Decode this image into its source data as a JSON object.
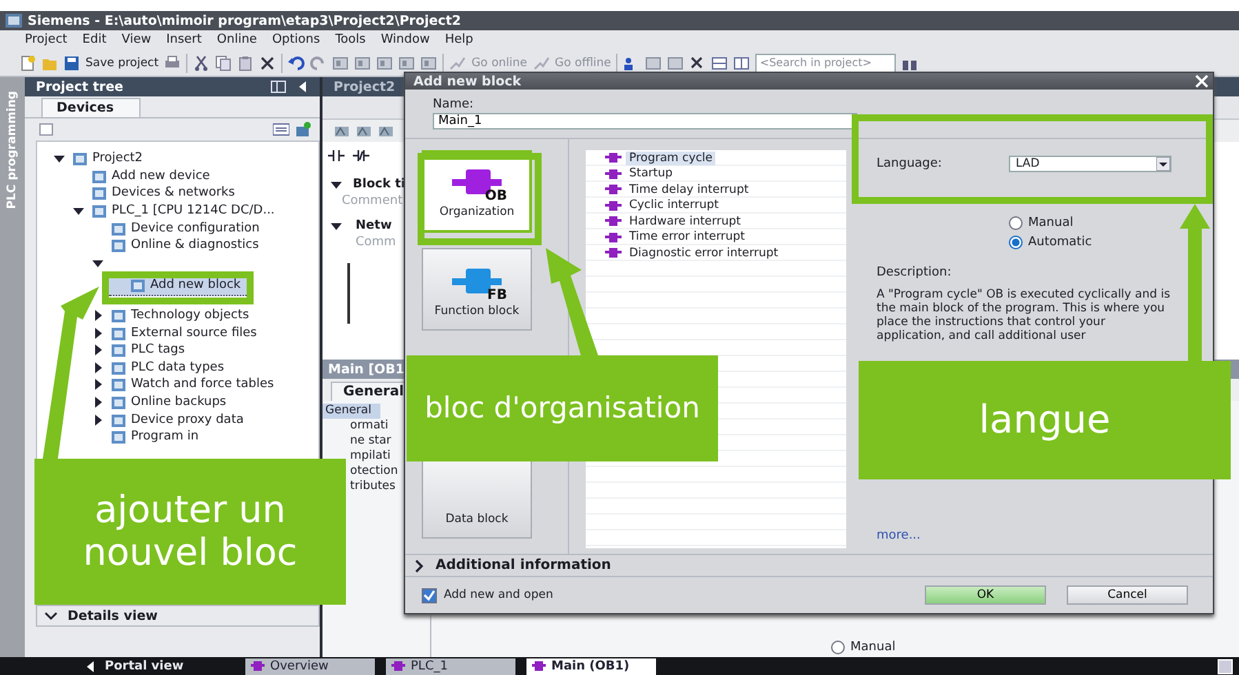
{
  "window": {
    "title": "Siemens - E:\\auto\\mimoir program\\etap3\\Project2\\Project2"
  },
  "menu": [
    "Project",
    "Edit",
    "View",
    "Insert",
    "Online",
    "Options",
    "Tools",
    "Window",
    "Help"
  ],
  "toolbar": {
    "save_label": "Save project",
    "go_online": "Go online",
    "go_offline": "Go offline",
    "search": {
      "placeholder": "<Search in project>"
    }
  },
  "side_tab": {
    "label": "PLC programming"
  },
  "project_tree": {
    "title": "Project tree",
    "tab": "Devices",
    "items": [
      {
        "label": "Project2",
        "expanded": true,
        "selected": false,
        "children": [
          {
            "label": "Add new device",
            "selected": false
          },
          {
            "label": "Devices & networks",
            "selected": false
          },
          {
            "label": "PLC_1 [CPU 1214C DC/D...",
            "expanded": true,
            "selected": false,
            "children": [
              {
                "label": "Device configuration",
                "selected": false
              },
              {
                "label": "Online & diagnostics",
                "selected": false
              },
              {
                "expanded": true,
                "selected": false,
                "children": [
                  {
                    "label": "Add new block",
                    "selected": true
                  }
                ]
              },
              {
                "label": "Technology objects",
                "expanded": false,
                "selected": false
              },
              {
                "label": "External source files",
                "expanded": false,
                "selected": false
              },
              {
                "label": "PLC tags",
                "expanded": false,
                "selected": false
              },
              {
                "label": "PLC data types",
                "expanded": false,
                "selected": false
              },
              {
                "label": "Watch and force tables",
                "expanded": false,
                "selected": false
              },
              {
                "label": "Online backups",
                "expanded": false,
                "selected": false
              },
              {
                "label": "Device proxy data",
                "expanded": false,
                "selected": false
              },
              {
                "label": "Program in",
                "selected": false
              }
            ]
          }
        ]
      }
    ],
    "details_view": "Details view"
  },
  "editor": {
    "breadcrumb": "Project2",
    "block_title": "Block ti",
    "comment": "Comment",
    "network": "Netw",
    "network_comment": "Comm",
    "properties": {
      "title": "Main [OB1",
      "tab": "General",
      "items": [
        "General",
        "ormati",
        "ne star",
        "mpilati",
        "otection",
        "tributes"
      ]
    },
    "manual": {
      "label": "Manual",
      "selected": false
    }
  },
  "dialog": {
    "title": "Add new block",
    "name_label": "Name:",
    "name_value": "Main_1",
    "block_types": [
      {
        "kind": "ob",
        "code": "OB",
        "label": "Organization",
        "selected": true
      },
      {
        "kind": "fb",
        "code": "FB",
        "label": "Function block",
        "selected": false
      },
      {
        "kind": "plain",
        "label": "Data block",
        "selected": false
      }
    ],
    "ob_types": [
      {
        "label": "Program cycle",
        "selected": true
      },
      {
        "label": "Startup",
        "selected": false
      },
      {
        "label": "Time delay interrupt",
        "selected": false
      },
      {
        "label": "Cyclic interrupt",
        "selected": false
      },
      {
        "label": "Hardware interrupt",
        "selected": false
      },
      {
        "label": "Time error interrupt",
        "selected": false
      },
      {
        "label": "Diagnostic error interrupt",
        "selected": false
      }
    ],
    "language_label": "Language:",
    "language_value": "LAD",
    "numbering": [
      {
        "label": "Manual",
        "selected": false
      },
      {
        "label": "Automatic",
        "selected": true
      }
    ],
    "description_label": "Description:",
    "description": "A \"Program cycle\" OB is executed cyclically and is the main block of the program. This is where you place the instructions that control your application, and call additional user",
    "more_link": "more...",
    "additional_info": "Additional information",
    "add_and_open": {
      "label": "Add new and open",
      "checked": true
    },
    "ok": "OK",
    "cancel": "Cancel"
  },
  "annotations": [
    {
      "text": "ajouter un nouvel bloc"
    },
    {
      "text": "bloc d'organisation"
    },
    {
      "text": "langue"
    }
  ],
  "taskbar": {
    "portal": "Portal view",
    "tabs": [
      {
        "label": "Overview",
        "selected": false
      },
      {
        "label": "PLC_1",
        "selected": false
      },
      {
        "label": "Main (OB1)",
        "selected": true
      }
    ]
  }
}
